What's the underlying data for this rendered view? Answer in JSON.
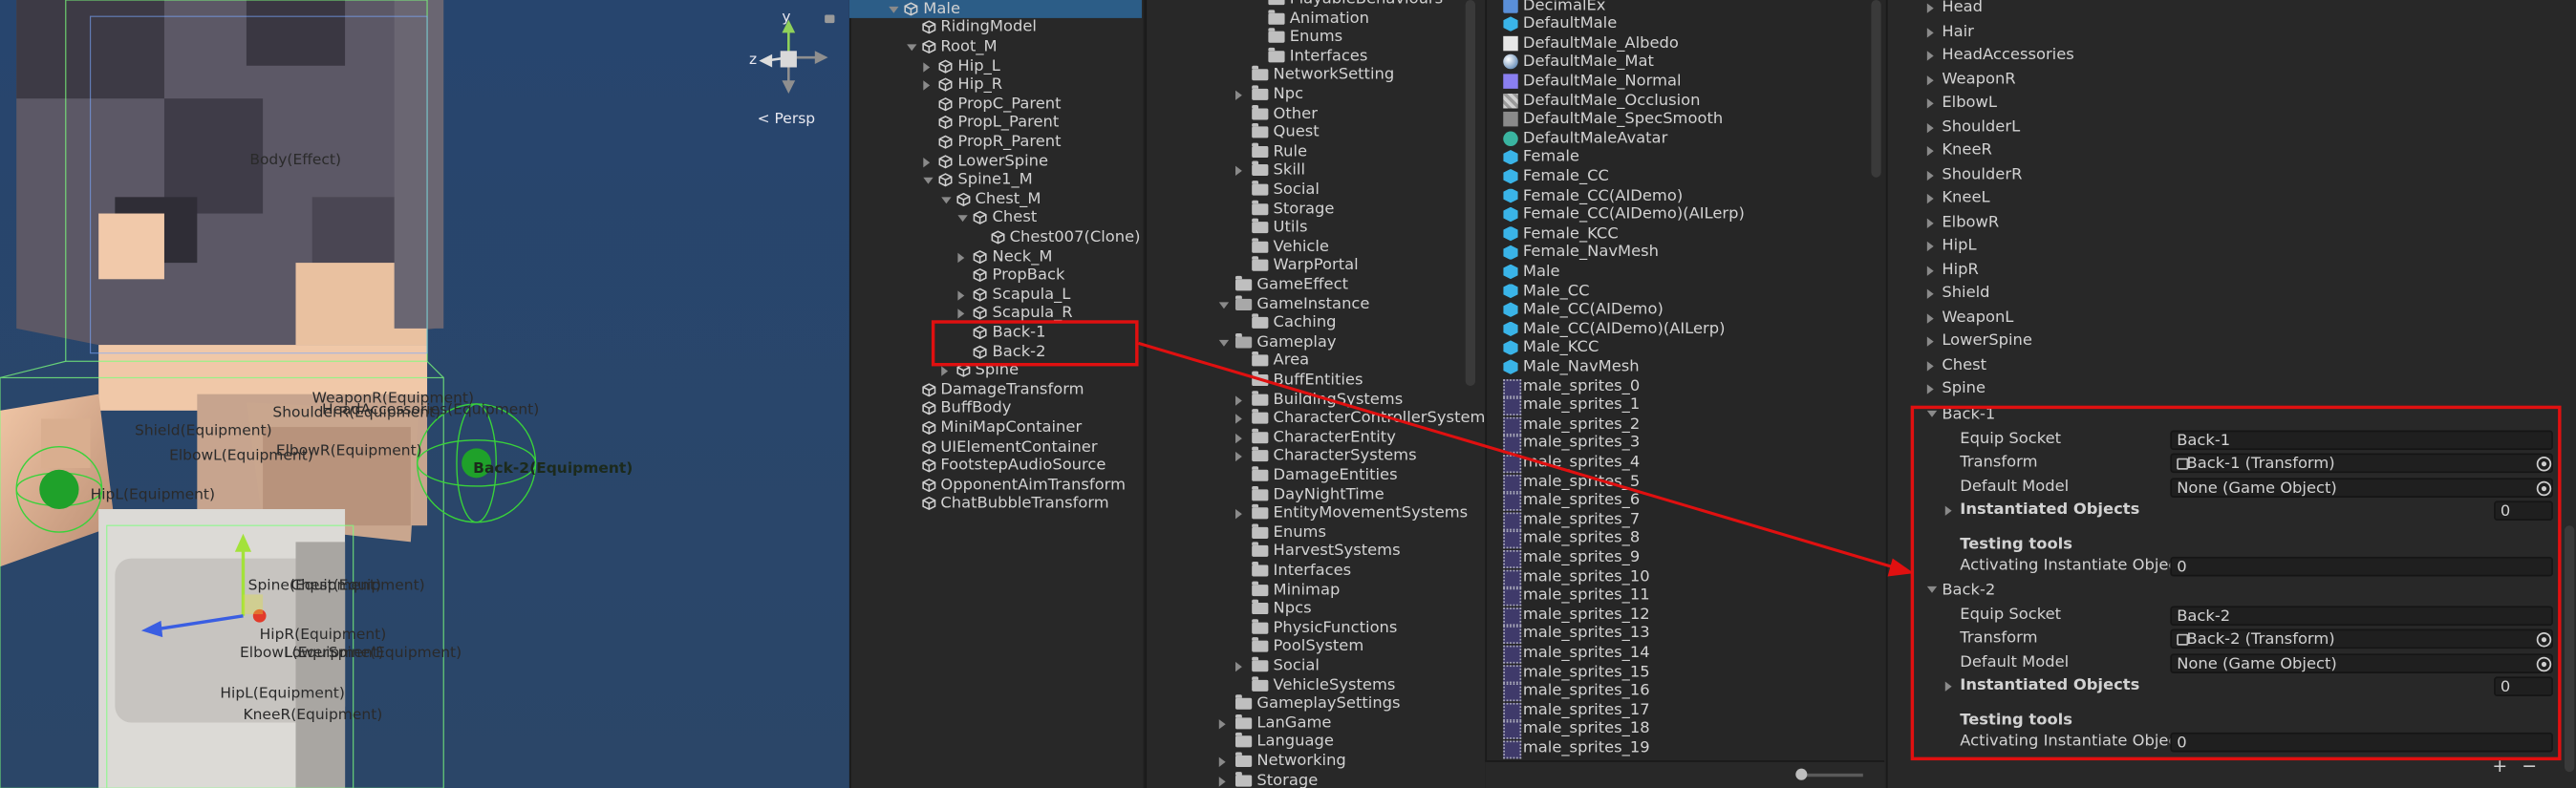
{
  "scene": {
    "persp_label": "< Persp",
    "axis_y": "y",
    "axis_z": "z",
    "labels": [
      "Body(Effect)",
      "WeaponR(Equipment)",
      "Shield(Equipment)",
      "ShoulderR(Equipment)",
      "HeadAccessories(Equipment)",
      "ElbowL(Equipment)",
      "ElbowR(Equipment)",
      "HipL(Equipment)",
      "Back-2(Equipment)",
      "Spine(Equipment)",
      "Chest(Equipment)",
      "HipR(Equipment)",
      "ElbowL(Equipment)",
      "LowerSpine(Equipment)",
      "HipL(Equipment)",
      "KneeR(Equipment)"
    ]
  },
  "hierarchy": {
    "items": [
      {
        "label": "Male",
        "depth": 0,
        "expand": "down",
        "selected": true
      },
      {
        "label": "RidingModel",
        "depth": 1,
        "expand": "none"
      },
      {
        "label": "Root_M",
        "depth": 1,
        "expand": "down"
      },
      {
        "label": "Hip_L",
        "depth": 2,
        "expand": "right"
      },
      {
        "label": "Hip_R",
        "depth": 2,
        "expand": "right"
      },
      {
        "label": "PropC_Parent",
        "depth": 2,
        "expand": "none"
      },
      {
        "label": "PropL_Parent",
        "depth": 2,
        "expand": "none"
      },
      {
        "label": "PropR_Parent",
        "depth": 2,
        "expand": "none"
      },
      {
        "label": "LowerSpine",
        "depth": 2,
        "expand": "right"
      },
      {
        "label": "Spine1_M",
        "depth": 2,
        "expand": "down"
      },
      {
        "label": "Chest_M",
        "depth": 3,
        "expand": "down"
      },
      {
        "label": "Chest",
        "depth": 4,
        "expand": "down"
      },
      {
        "label": "Chest007(Clone)",
        "depth": 5,
        "expand": "none"
      },
      {
        "label": "Neck_M",
        "depth": 4,
        "expand": "right"
      },
      {
        "label": "PropBack",
        "depth": 4,
        "expand": "none"
      },
      {
        "label": "Scapula_L",
        "depth": 4,
        "expand": "right"
      },
      {
        "label": "Scapula_R",
        "depth": 4,
        "expand": "right"
      },
      {
        "label": "Back-1",
        "depth": 4,
        "expand": "none"
      },
      {
        "label": "Back-2",
        "depth": 4,
        "expand": "none"
      },
      {
        "label": "Spine",
        "depth": 3,
        "expand": "right"
      },
      {
        "label": "DamageTransform",
        "depth": 1,
        "expand": "none"
      },
      {
        "label": "BuffBody",
        "depth": 1,
        "expand": "none"
      },
      {
        "label": "MiniMapContainer",
        "depth": 1,
        "expand": "none"
      },
      {
        "label": "UIElementContainer",
        "depth": 1,
        "expand": "none"
      },
      {
        "label": "FootstepAudioSource",
        "depth": 1,
        "expand": "none"
      },
      {
        "label": "OpponentAimTransform",
        "depth": 1,
        "expand": "none"
      },
      {
        "label": "ChatBubbleTransform",
        "depth": 1,
        "expand": "none"
      }
    ]
  },
  "project": {
    "items": [
      {
        "label": "PlayableBehaviours",
        "depth": 2,
        "expand": "none"
      },
      {
        "label": "Animation",
        "depth": 2,
        "expand": "none"
      },
      {
        "label": "Enums",
        "depth": 2,
        "expand": "none"
      },
      {
        "label": "Interfaces",
        "depth": 2,
        "expand": "none"
      },
      {
        "label": "NetworkSetting",
        "depth": 1,
        "expand": "none"
      },
      {
        "label": "Npc",
        "depth": 1,
        "expand": "right"
      },
      {
        "label": "Other",
        "depth": 1,
        "expand": "none"
      },
      {
        "label": "Quest",
        "depth": 1,
        "expand": "none"
      },
      {
        "label": "Rule",
        "depth": 1,
        "expand": "none"
      },
      {
        "label": "Skill",
        "depth": 1,
        "expand": "right"
      },
      {
        "label": "Social",
        "depth": 1,
        "expand": "none"
      },
      {
        "label": "Storage",
        "depth": 1,
        "expand": "none"
      },
      {
        "label": "Utils",
        "depth": 1,
        "expand": "none"
      },
      {
        "label": "Vehicle",
        "depth": 1,
        "expand": "none"
      },
      {
        "label": "WarpPortal",
        "depth": 1,
        "expand": "none"
      },
      {
        "label": "GameEffect",
        "depth": 0,
        "expand": "none"
      },
      {
        "label": "GameInstance",
        "depth": 0,
        "expand": "down"
      },
      {
        "label": "Caching",
        "depth": 1,
        "expand": "none"
      },
      {
        "label": "Gameplay",
        "depth": 0,
        "expand": "down"
      },
      {
        "label": "Area",
        "depth": 1,
        "expand": "none"
      },
      {
        "label": "BuffEntities",
        "depth": 1,
        "expand": "none"
      },
      {
        "label": "BuildingSystems",
        "depth": 1,
        "expand": "right"
      },
      {
        "label": "CharacterControllerSystems",
        "depth": 1,
        "expand": "right"
      },
      {
        "label": "CharacterEntity",
        "depth": 1,
        "expand": "right"
      },
      {
        "label": "CharacterSystems",
        "depth": 1,
        "expand": "right"
      },
      {
        "label": "DamageEntities",
        "depth": 1,
        "expand": "none"
      },
      {
        "label": "DayNightTime",
        "depth": 1,
        "expand": "none"
      },
      {
        "label": "EntityMovementSystems",
        "depth": 1,
        "expand": "right"
      },
      {
        "label": "Enums",
        "depth": 1,
        "expand": "none"
      },
      {
        "label": "HarvestSystems",
        "depth": 1,
        "expand": "none"
      },
      {
        "label": "Interfaces",
        "depth": 1,
        "expand": "none"
      },
      {
        "label": "Minimap",
        "depth": 1,
        "expand": "none"
      },
      {
        "label": "Npcs",
        "depth": 1,
        "expand": "none"
      },
      {
        "label": "PhysicFunctions",
        "depth": 1,
        "expand": "none"
      },
      {
        "label": "PoolSystem",
        "depth": 1,
        "expand": "none"
      },
      {
        "label": "Social",
        "depth": 1,
        "expand": "right"
      },
      {
        "label": "VehicleSystems",
        "depth": 1,
        "expand": "none"
      },
      {
        "label": "GameplaySettings",
        "depth": 0,
        "expand": "none"
      },
      {
        "label": "LanGame",
        "depth": 0,
        "expand": "right"
      },
      {
        "label": "Language",
        "depth": 0,
        "expand": "none"
      },
      {
        "label": "Networking",
        "depth": 0,
        "expand": "right"
      },
      {
        "label": "Storage",
        "depth": 0,
        "expand": "right"
      }
    ]
  },
  "assets": {
    "items": [
      {
        "label": "DecimalEx",
        "icon": "script"
      },
      {
        "label": "DefaultMale",
        "icon": "prefab"
      },
      {
        "label": "DefaultMale_Albedo",
        "icon": "texture"
      },
      {
        "label": "DefaultMale_Mat",
        "icon": "material"
      },
      {
        "label": "DefaultMale_Normal",
        "icon": "normal"
      },
      {
        "label": "DefaultMale_Occlusion",
        "icon": "light"
      },
      {
        "label": "DefaultMale_SpecSmooth",
        "icon": "gray"
      },
      {
        "label": "DefaultMaleAvatar",
        "icon": "avatar"
      },
      {
        "label": "Female",
        "icon": "prefab"
      },
      {
        "label": "Female_CC",
        "icon": "prefab"
      },
      {
        "label": "Female_CC(AIDemo)",
        "icon": "prefab"
      },
      {
        "label": "Female_CC(AIDemo)(AILerp)",
        "icon": "prefab"
      },
      {
        "label": "Female_KCC",
        "icon": "prefab"
      },
      {
        "label": "Female_NavMesh",
        "icon": "prefab"
      },
      {
        "label": "Male",
        "icon": "prefab"
      },
      {
        "label": "Male_CC",
        "icon": "prefab"
      },
      {
        "label": "Male_CC(AIDemo)",
        "icon": "prefab"
      },
      {
        "label": "Male_CC(AIDemo)(AILerp)",
        "icon": "prefab"
      },
      {
        "label": "Male_KCC",
        "icon": "prefab"
      },
      {
        "label": "Male_NavMesh",
        "icon": "prefab"
      },
      {
        "label": "male_sprites_0",
        "icon": "sprite"
      },
      {
        "label": "male_sprites_1",
        "icon": "sprite"
      },
      {
        "label": "male_sprites_2",
        "icon": "sprite"
      },
      {
        "label": "male_sprites_3",
        "icon": "sprite"
      },
      {
        "label": "male_sprites_4",
        "icon": "sprite"
      },
      {
        "label": "male_sprites_5",
        "icon": "sprite"
      },
      {
        "label": "male_sprites_6",
        "icon": "sprite"
      },
      {
        "label": "male_sprites_7",
        "icon": "sprite"
      },
      {
        "label": "male_sprites_8",
        "icon": "sprite"
      },
      {
        "label": "male_sprites_9",
        "icon": "sprite"
      },
      {
        "label": "male_sprites_10",
        "icon": "sprite"
      },
      {
        "label": "male_sprites_11",
        "icon": "sprite"
      },
      {
        "label": "male_sprites_12",
        "icon": "sprite"
      },
      {
        "label": "male_sprites_13",
        "icon": "sprite"
      },
      {
        "label": "male_sprites_14",
        "icon": "sprite"
      },
      {
        "label": "male_sprites_15",
        "icon": "sprite"
      },
      {
        "label": "male_sprites_16",
        "icon": "sprite"
      },
      {
        "label": "male_sprites_17",
        "icon": "sprite"
      },
      {
        "label": "male_sprites_18",
        "icon": "sprite"
      },
      {
        "label": "male_sprites_19",
        "icon": "sprite"
      }
    ]
  },
  "inspector": {
    "bones": [
      "Head",
      "Hair",
      "HeadAccessories",
      "WeaponR",
      "ElbowL",
      "ShoulderL",
      "KneeR",
      "ShoulderR",
      "KneeL",
      "ElbowR",
      "HipL",
      "HipR",
      "Shield",
      "WeaponL",
      "LowerSpine",
      "Chest",
      "Spine"
    ],
    "sockets": [
      {
        "name": "Back-1",
        "equip_socket_label": "Equip Socket",
        "equip_socket_value": "Back-1",
        "transform_label": "Transform",
        "transform_value": "Back-1 (Transform)",
        "default_model_label": "Default Model",
        "default_model_value": "None (Game Object)",
        "instantiated_label": "Instantiated Objects",
        "instantiated_count": "0",
        "testing_label": "Testing tools",
        "activating_label": "Activating Instantiate Object I",
        "activating_value": "0"
      },
      {
        "name": "Back-2",
        "equip_socket_label": "Equip Socket",
        "equip_socket_value": "Back-2",
        "transform_label": "Transform",
        "transform_value": "Back-2 (Transform)",
        "default_model_label": "Default Model",
        "default_model_value": "None (Game Object)",
        "instantiated_label": "Instantiated Objects",
        "instantiated_count": "0",
        "testing_label": "Testing tools",
        "activating_label": "Activating Instantiate Object I",
        "activating_value": "0"
      }
    ],
    "add_label": "+",
    "remove_label": "−"
  },
  "colors": {
    "selection": "#2c5d87",
    "annotation_red": "#e01010",
    "scene_bg": "#2f4a6e"
  }
}
